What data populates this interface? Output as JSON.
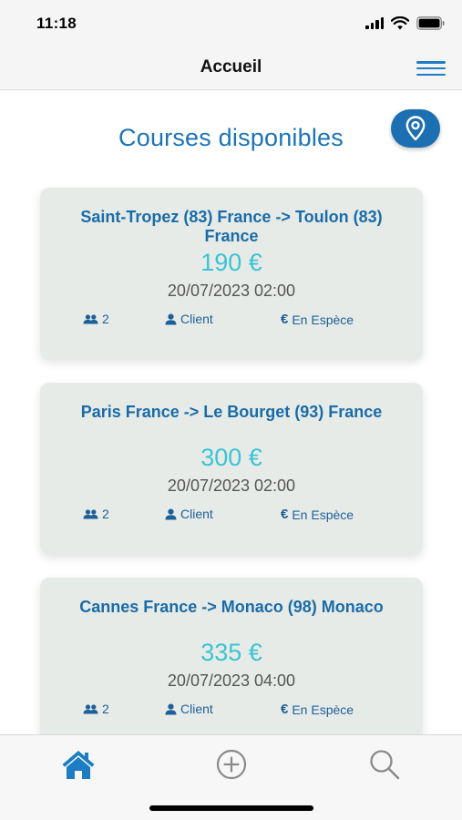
{
  "status_bar": {
    "time": "11:18"
  },
  "nav": {
    "title": "Accueil",
    "menu_icon": "hamburger-icon"
  },
  "page": {
    "title": "Courses disponibles",
    "location_icon": "map-pin-icon"
  },
  "courses": [
    {
      "route": "Saint-Tropez (83) France -> Toulon (83) France",
      "price": "190 €",
      "date": "20/07/2023 02:00",
      "passengers": "2",
      "client": "Client",
      "payment": "En Espèce"
    },
    {
      "route": "Paris France -> Le Bourget (93) France",
      "price": "300 €",
      "date": "20/07/2023 02:00",
      "passengers": "2",
      "client": "Client",
      "payment": "En Espèce"
    },
    {
      "route": "Cannes France -> Monaco (98) Monaco",
      "price": "335 €",
      "date": "20/07/2023 04:00",
      "passengers": "2",
      "client": "Client",
      "payment": "En Espèce"
    }
  ],
  "tabs": [
    {
      "icon": "home-icon",
      "active": true
    },
    {
      "icon": "add-circle-icon",
      "active": false
    },
    {
      "icon": "search-icon",
      "active": false
    }
  ],
  "colors": {
    "accent": "#1c74b8",
    "price": "#3bc4d3",
    "card_bg": "#e7ebe8",
    "tab_active": "#1c7dc4",
    "tab_inactive": "#8a8a8a"
  }
}
